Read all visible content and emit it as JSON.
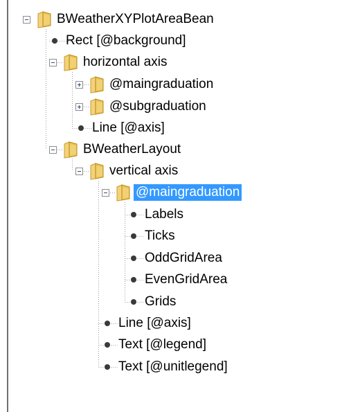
{
  "tree": {
    "nodes": [
      {
        "label": "BWeatherXYPlotAreaBean",
        "icon": "folder-icon",
        "expander": "expanded"
      },
      {
        "label": "Rect [@background]",
        "icon": "bullet-icon"
      },
      {
        "label": "horizontal axis",
        "icon": "folder-icon",
        "expander": "expanded"
      },
      {
        "label": "@maingraduation",
        "icon": "folder-icon",
        "expander": "collapsed"
      },
      {
        "label": "@subgraduation",
        "icon": "folder-icon",
        "expander": "collapsed"
      },
      {
        "label": "Line [@axis]",
        "icon": "bullet-icon"
      },
      {
        "label": "BWeatherLayout",
        "icon": "folder-icon",
        "expander": "expanded"
      },
      {
        "label": "vertical axis",
        "icon": "folder-icon",
        "expander": "expanded"
      },
      {
        "label": "@maingraduation",
        "icon": "folder-icon",
        "expander": "expanded",
        "selected": true
      },
      {
        "label": "Labels",
        "icon": "bullet-icon"
      },
      {
        "label": "Ticks",
        "icon": "bullet-icon"
      },
      {
        "label": "OddGridArea",
        "icon": "bullet-icon"
      },
      {
        "label": "EvenGridArea",
        "icon": "bullet-icon"
      },
      {
        "label": "Grids",
        "icon": "bullet-icon"
      },
      {
        "label": "Line [@axis]",
        "icon": "bullet-icon"
      },
      {
        "label": "Text [@legend]",
        "icon": "bullet-icon"
      },
      {
        "label": "Text [@unitlegend]",
        "icon": "bullet-icon"
      }
    ]
  },
  "colors": {
    "selection": "#3399ff",
    "folder": "#e8c04a",
    "bullet": "#3a3a3a"
  }
}
